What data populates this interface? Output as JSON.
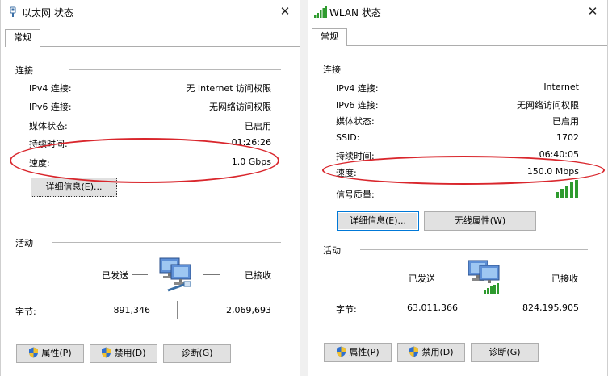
{
  "ethernet": {
    "title": "以太网 状态",
    "tab": "常规",
    "connection_group": "连接",
    "rows": [
      {
        "label": "IPv4 连接:",
        "value": "无 Internet 访问权限"
      },
      {
        "label": "IPv6 连接:",
        "value": "无网络访问权限"
      },
      {
        "label": "媒体状态:",
        "value": "已启用"
      },
      {
        "label": "持续时间:",
        "value": "01:26:26"
      },
      {
        "label": "速度:",
        "value": "1.0 Gbps"
      }
    ],
    "details_button": "详细信息(E)...",
    "activity_group": "活动",
    "sent_label": "已发送",
    "received_label": "已接收",
    "bytes_label": "字节:",
    "bytes_sent": "891,346",
    "bytes_received": "2,069,693",
    "buttons": {
      "properties": "属性(P)",
      "disable": "禁用(D)",
      "diagnose": "诊断(G)"
    }
  },
  "wlan": {
    "title": "WLAN 状态",
    "tab": "常规",
    "connection_group": "连接",
    "rows": [
      {
        "label": "IPv4 连接:",
        "value": "Internet"
      },
      {
        "label": "IPv6 连接:",
        "value": "无网络访问权限"
      },
      {
        "label": "媒体状态:",
        "value": "已启用"
      },
      {
        "label": "SSID:",
        "value": "1702"
      },
      {
        "label": "持续时间:",
        "value": "06:40:05"
      },
      {
        "label": "速度:",
        "value": "150.0 Mbps"
      }
    ],
    "signal_label": "信号质量:",
    "details_button": "详细信息(E)...",
    "wireless_props_button": "无线属性(W)",
    "activity_group": "活动",
    "sent_label": "已发送",
    "received_label": "已接收",
    "bytes_label": "字节:",
    "bytes_sent": "63,011,366",
    "bytes_received": "824,195,905",
    "buttons": {
      "properties": "属性(P)",
      "disable": "禁用(D)",
      "diagnose": "诊断(G)"
    }
  },
  "colors": {
    "annotation": "#d9262c",
    "focus": "#0078d7",
    "signal": "#2e9b2e"
  }
}
